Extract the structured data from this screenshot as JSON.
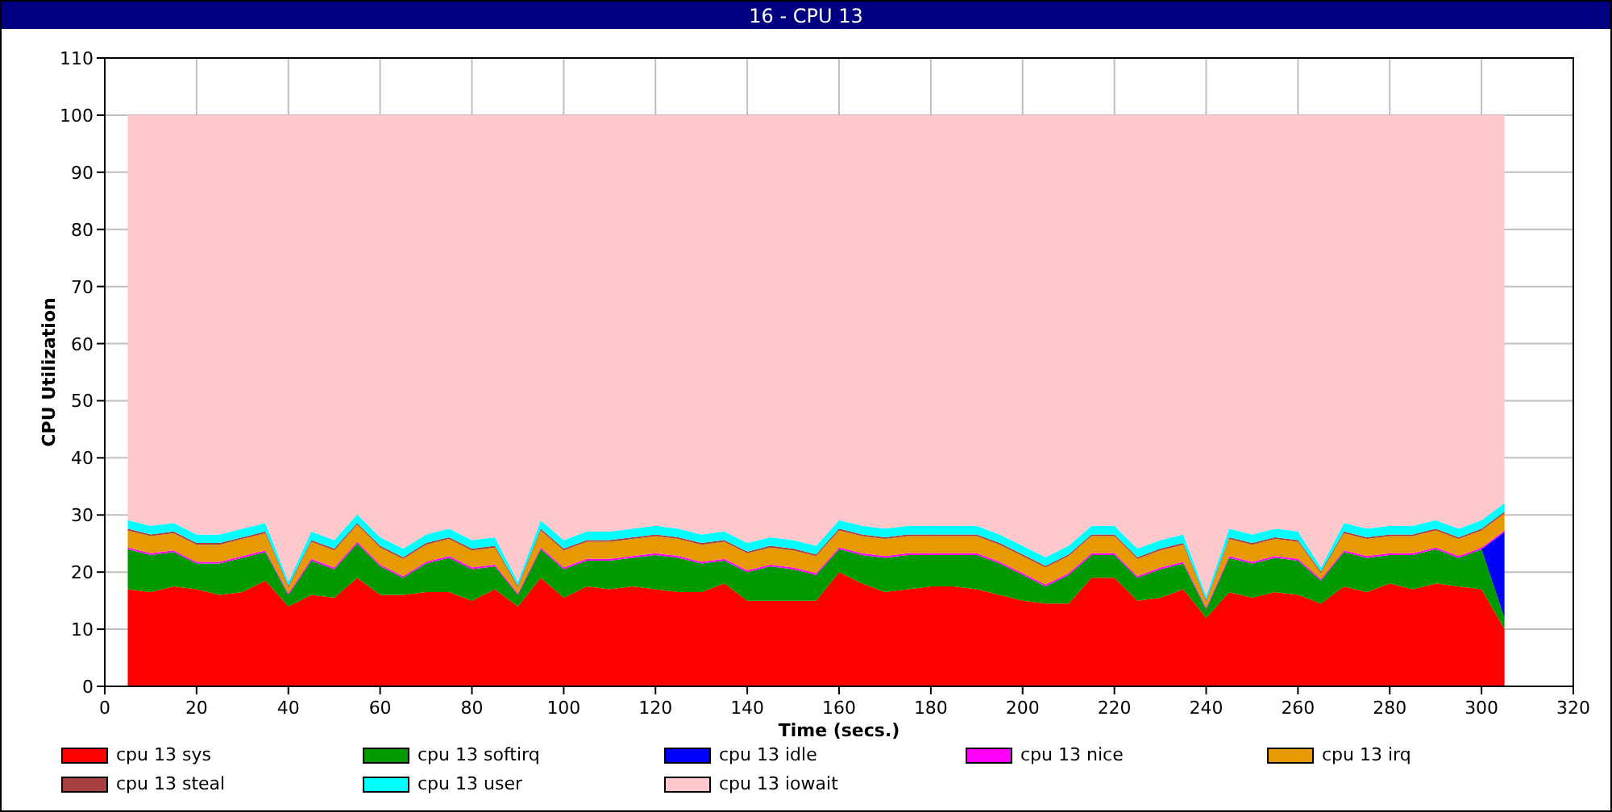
{
  "window": {
    "title": "16 - CPU 13"
  },
  "chart": {
    "chart_data": {
      "type": "area",
      "stacked": true,
      "grid": true,
      "xlabel": "Time (secs.)",
      "ylabel": "CPU Utilization",
      "xlim": [
        0,
        320
      ],
      "ylim": [
        0,
        110
      ],
      "xticks": [
        0,
        20,
        40,
        60,
        80,
        100,
        120,
        140,
        160,
        180,
        200,
        220,
        240,
        260,
        280,
        300,
        320
      ],
      "yticks": [
        0,
        10,
        20,
        30,
        40,
        50,
        60,
        70,
        80,
        90,
        100,
        110
      ],
      "x": [
        5,
        10,
        15,
        20,
        25,
        30,
        35,
        40,
        45,
        50,
        55,
        60,
        65,
        70,
        75,
        80,
        85,
        90,
        95,
        100,
        105,
        110,
        115,
        120,
        125,
        130,
        135,
        140,
        145,
        150,
        155,
        160,
        165,
        170,
        175,
        180,
        185,
        190,
        195,
        200,
        205,
        210,
        215,
        220,
        225,
        230,
        235,
        240,
        245,
        250,
        255,
        260,
        265,
        270,
        275,
        280,
        285,
        290,
        295,
        300,
        305
      ],
      "series": [
        {
          "name": "cpu 13 sys",
          "color": "#ff0000",
          "values": [
            17,
            16.5,
            17.5,
            17,
            16,
            16.5,
            18.5,
            14,
            16,
            15.5,
            19,
            16,
            16,
            16.5,
            16.5,
            15,
            17,
            14,
            19,
            15.5,
            17.5,
            17,
            17.5,
            17,
            16.5,
            16.5,
            18,
            15,
            15,
            15,
            15,
            20,
            18,
            16.5,
            17,
            17.5,
            17.5,
            17,
            16,
            15,
            14.5,
            14.5,
            19,
            19,
            15,
            15.5,
            17,
            12,
            16.5,
            15.5,
            16.5,
            16,
            14.5,
            17.5,
            16.5,
            18,
            17,
            18,
            17.5,
            17,
            10
          ]
        },
        {
          "name": "cpu 13 softirq",
          "color": "#009900",
          "values": [
            7,
            6.5,
            6,
            4.5,
            5.5,
            6,
            5,
            2,
            6,
            5,
            6,
            5,
            3,
            5,
            6,
            5.5,
            4,
            2,
            5,
            5,
            4.5,
            5,
            5,
            6,
            6,
            5,
            4,
            5,
            6,
            5.5,
            4.5,
            4,
            5,
            6,
            6,
            5.5,
            5.5,
            6,
            5.5,
            4.5,
            3,
            5,
            4,
            4,
            4,
            5,
            4.5,
            1.5,
            6,
            6,
            6,
            6,
            4,
            6,
            6,
            5,
            6,
            6,
            5,
            7,
            2
          ]
        },
        {
          "name": "cpu 13 idle",
          "color": "#0000ff",
          "values": [
            0,
            0,
            0,
            0,
            0,
            0,
            0,
            0,
            0,
            0,
            0,
            0,
            0,
            0,
            0,
            0,
            0,
            0,
            0,
            0,
            0,
            0,
            0,
            0,
            0,
            0,
            0,
            0,
            0,
            0,
            0,
            0,
            0,
            0,
            0,
            0,
            0,
            0,
            0,
            0,
            0,
            0,
            0,
            0,
            0,
            0,
            0,
            0,
            0,
            0,
            0,
            0,
            0,
            0,
            0,
            0,
            0,
            0,
            0,
            0,
            15
          ]
        },
        {
          "name": "cpu 13 nice",
          "color": "#ff00ff",
          "values": [
            0.3,
            0.3,
            0.3,
            0.3,
            0.3,
            0.3,
            0.3,
            0.3,
            0.3,
            0.3,
            0.3,
            0.3,
            0.3,
            0.3,
            0.3,
            0.3,
            0.3,
            0.3,
            0.3,
            0.3,
            0.3,
            0.3,
            0.3,
            0.3,
            0.3,
            0.3,
            0.3,
            0.3,
            0.3,
            0.3,
            0.3,
            0.3,
            0.3,
            0.3,
            0.3,
            0.3,
            0.3,
            0.3,
            0.3,
            0.3,
            0.3,
            0.3,
            0.3,
            0.3,
            0.3,
            0.3,
            0.3,
            0.3,
            0.3,
            0.3,
            0.3,
            0.3,
            0.3,
            0.3,
            0.3,
            0.3,
            0.3,
            0.3,
            0.3,
            0.3,
            0.3
          ]
        },
        {
          "name": "cpu 13 irq",
          "color": "#e69900",
          "values": [
            3,
            3,
            3,
            3,
            3,
            3,
            3,
            1,
            3,
            3,
            3,
            3,
            3,
            3,
            3,
            3,
            3,
            1,
            3,
            3,
            3,
            3,
            3,
            3,
            3,
            3,
            3,
            3,
            3,
            3,
            3,
            3,
            3,
            3,
            3,
            3,
            3,
            3,
            3,
            3,
            3,
            3,
            3,
            3,
            3,
            3,
            3,
            1,
            3,
            3,
            3,
            3,
            1,
            3,
            3,
            3,
            3,
            3,
            3,
            3,
            3
          ]
        },
        {
          "name": "cpu 13 steal",
          "color": "#a94040",
          "values": [
            0.3,
            0.3,
            0.3,
            0.3,
            0.3,
            0.3,
            0.3,
            0.3,
            0.3,
            0.3,
            0.3,
            0.3,
            0.3,
            0.3,
            0.3,
            0.3,
            0.3,
            0.3,
            0.3,
            0.3,
            0.3,
            0.3,
            0.3,
            0.3,
            0.3,
            0.3,
            0.3,
            0.3,
            0.3,
            0.3,
            0.3,
            0.3,
            0.3,
            0.3,
            0.3,
            0.3,
            0.3,
            0.3,
            0.3,
            0.3,
            0.3,
            0.3,
            0.3,
            0.3,
            0.3,
            0.3,
            0.3,
            0.3,
            0.3,
            0.3,
            0.3,
            0.3,
            0.3,
            0.3,
            0.3,
            0.3,
            0.3,
            0.3,
            0.3,
            0.3,
            0.3
          ]
        },
        {
          "name": "cpu 13 user",
          "color": "#00ffff",
          "values": [
            1.5,
            1.5,
            1.5,
            1.5,
            1.5,
            1.5,
            1.5,
            0.7,
            1.5,
            1.5,
            1.5,
            1.5,
            1.5,
            1.5,
            1.5,
            1.5,
            1.5,
            0.7,
            1.5,
            1.5,
            1.5,
            1.5,
            1.5,
            1.5,
            1.5,
            1.5,
            1.5,
            1.5,
            1.5,
            1.5,
            1.5,
            1.5,
            1.5,
            1.5,
            1.5,
            1.5,
            1.5,
            1.5,
            1.5,
            1.5,
            1.5,
            1.5,
            1.5,
            1.5,
            1.5,
            1.5,
            1.5,
            0.7,
            1.5,
            1.5,
            1.5,
            1.5,
            0.7,
            1.5,
            1.5,
            1.5,
            1.5,
            1.5,
            1.5,
            1.5,
            1.5
          ]
        },
        {
          "name": "cpu 13 iowait",
          "color": "#ffc8cc",
          "values": [
            70.9,
            71.9,
            71.4,
            73.4,
            73.4,
            72.4,
            71.4,
            81.7,
            72.9,
            74.4,
            69.9,
            73.9,
            75.9,
            73.4,
            72.4,
            74.4,
            73.9,
            81.7,
            70.9,
            74.4,
            72.9,
            72.9,
            72.4,
            71.9,
            72.4,
            73.4,
            72.9,
            74.9,
            73.9,
            74.4,
            75.4,
            70.9,
            71.9,
            72.4,
            71.9,
            71.9,
            71.9,
            71.9,
            73.4,
            75.4,
            77.4,
            75.4,
            71.9,
            71.9,
            75.9,
            74.4,
            73.4,
            84.2,
            72.4,
            73.4,
            72.4,
            72.9,
            79.2,
            71.4,
            72.4,
            71.9,
            71.9,
            70.9,
            72.4,
            70.9,
            67.9
          ]
        }
      ]
    }
  }
}
